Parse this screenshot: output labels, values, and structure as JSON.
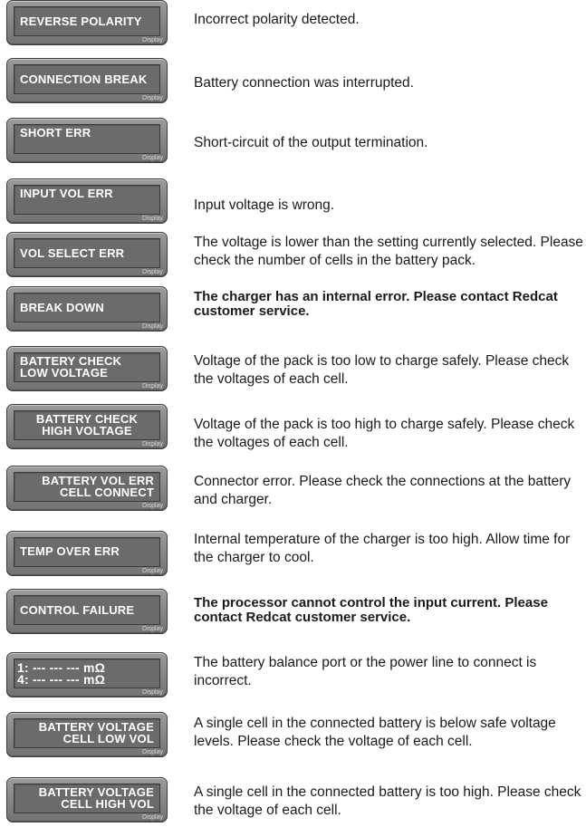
{
  "display_caption": "Display",
  "errors": [
    {
      "lines": [
        "REVERSE POLARITY"
      ],
      "description": "Incorrect polarity detected.",
      "bold": false
    },
    {
      "lines": [
        "CONNECTION BREAK"
      ],
      "description": "Battery connection was interrupted.",
      "bold": false
    },
    {
      "lines": [
        "SHORT ERR"
      ],
      "description": "Short-circuit of the output termination.",
      "bold": false
    },
    {
      "lines": [
        "INPUT VOL ERR"
      ],
      "description": "Input voltage is wrong.",
      "bold": false
    },
    {
      "lines": [
        "VOL SELECT ERR"
      ],
      "description": "The voltage is lower than the setting currently selected. Please check the number of cells in the battery pack.",
      "bold": false
    },
    {
      "lines": [
        "BREAK DOWN"
      ],
      "description": "The charger has an internal error. Please contact Redcat customer service.",
      "bold": true
    },
    {
      "lines": [
        "BATTERY CHECK",
        "LOW VOLTAGE"
      ],
      "description": "Voltage of the pack is too low to charge safely. Please check the voltages of each cell.",
      "bold": false
    },
    {
      "lines": [
        "BATTERY CHECK",
        "HIGH VOLTAGE"
      ],
      "description": "Voltage of the pack is too high to charge safely. Please check the voltages of each cell.",
      "bold": false
    },
    {
      "lines": [
        "BATTERY VOL ERR",
        "CELL CONNECT"
      ],
      "description": "Connector error. Please check the connections at the battery and charger.",
      "bold": false
    },
    {
      "lines": [
        "TEMP OVER ERR"
      ],
      "description": "Internal temperature of the charger is too high. Allow time for the charger to cool.",
      "bold": false
    },
    {
      "lines": [
        "CONTROL FAILURE"
      ],
      "description": "The processor cannot control the input current. Please contact Redcat customer service.",
      "bold": true
    },
    {
      "lines": [
        "1: --- --- --- mΩ",
        "4: --- --- --- mΩ"
      ],
      "description": "The battery balance port or the power line to connect is incorrect.",
      "bold": false
    },
    {
      "lines": [
        "BATTERY VOLTAGE",
        "CELL LOW VOL"
      ],
      "description": "A single cell in the connected battery is below safe voltage levels. Please check the voltage of each cell.",
      "bold": false
    },
    {
      "lines": [
        "BATTERY VOLTAGE",
        "CELL HIGH VOL"
      ],
      "description": "A single cell in the connected battery is too high. Please check the voltage of each cell.",
      "bold": false
    }
  ]
}
